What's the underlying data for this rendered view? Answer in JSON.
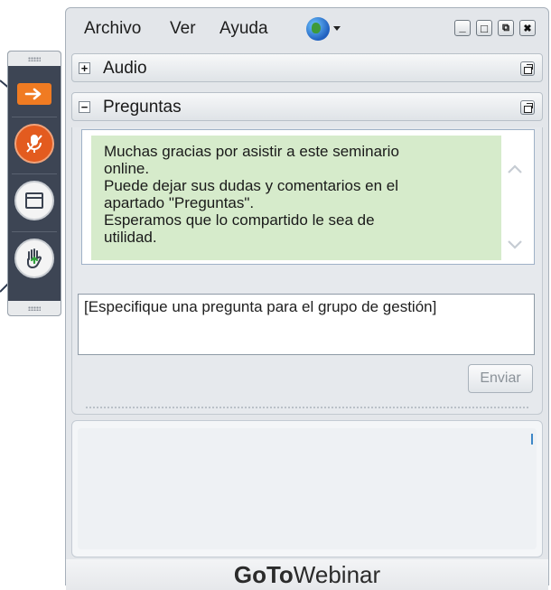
{
  "menu": {
    "archivo": "Archivo",
    "ver": "Ver",
    "ayuda": "Ayuda"
  },
  "window_buttons": {
    "minimize": "_",
    "maximize": "□",
    "restore": "⧉",
    "close": "✖"
  },
  "panels": {
    "audio": {
      "title": "Audio",
      "state_symbol": "+"
    },
    "questions": {
      "title": "Preguntas",
      "state_symbol": "−",
      "message_lines": [
        "Muchas gracias por asistir a este seminario",
        "online.",
        "Puede dejar sus dudas y comentarios en el",
        "apartado \"Preguntas\".",
        "Esperamos que lo compartido le sea de",
        "utilidad."
      ],
      "input_placeholder": "[Especifique una pregunta para el grupo de gestión]",
      "send_label": "Enviar"
    }
  },
  "brand": {
    "bold": "GoTo",
    "regular": "Webinar"
  },
  "colors": {
    "toolbar_bg": "#3d4554",
    "orange_accent": "#f07b22",
    "message_bg": "#d6ebcb"
  },
  "icons": {
    "toolbar": [
      "arrow-right-icon",
      "mic-muted-icon",
      "window-icon",
      "raise-hand-icon"
    ],
    "menu": [
      "globe-icon",
      "chevron-down-icon"
    ]
  }
}
